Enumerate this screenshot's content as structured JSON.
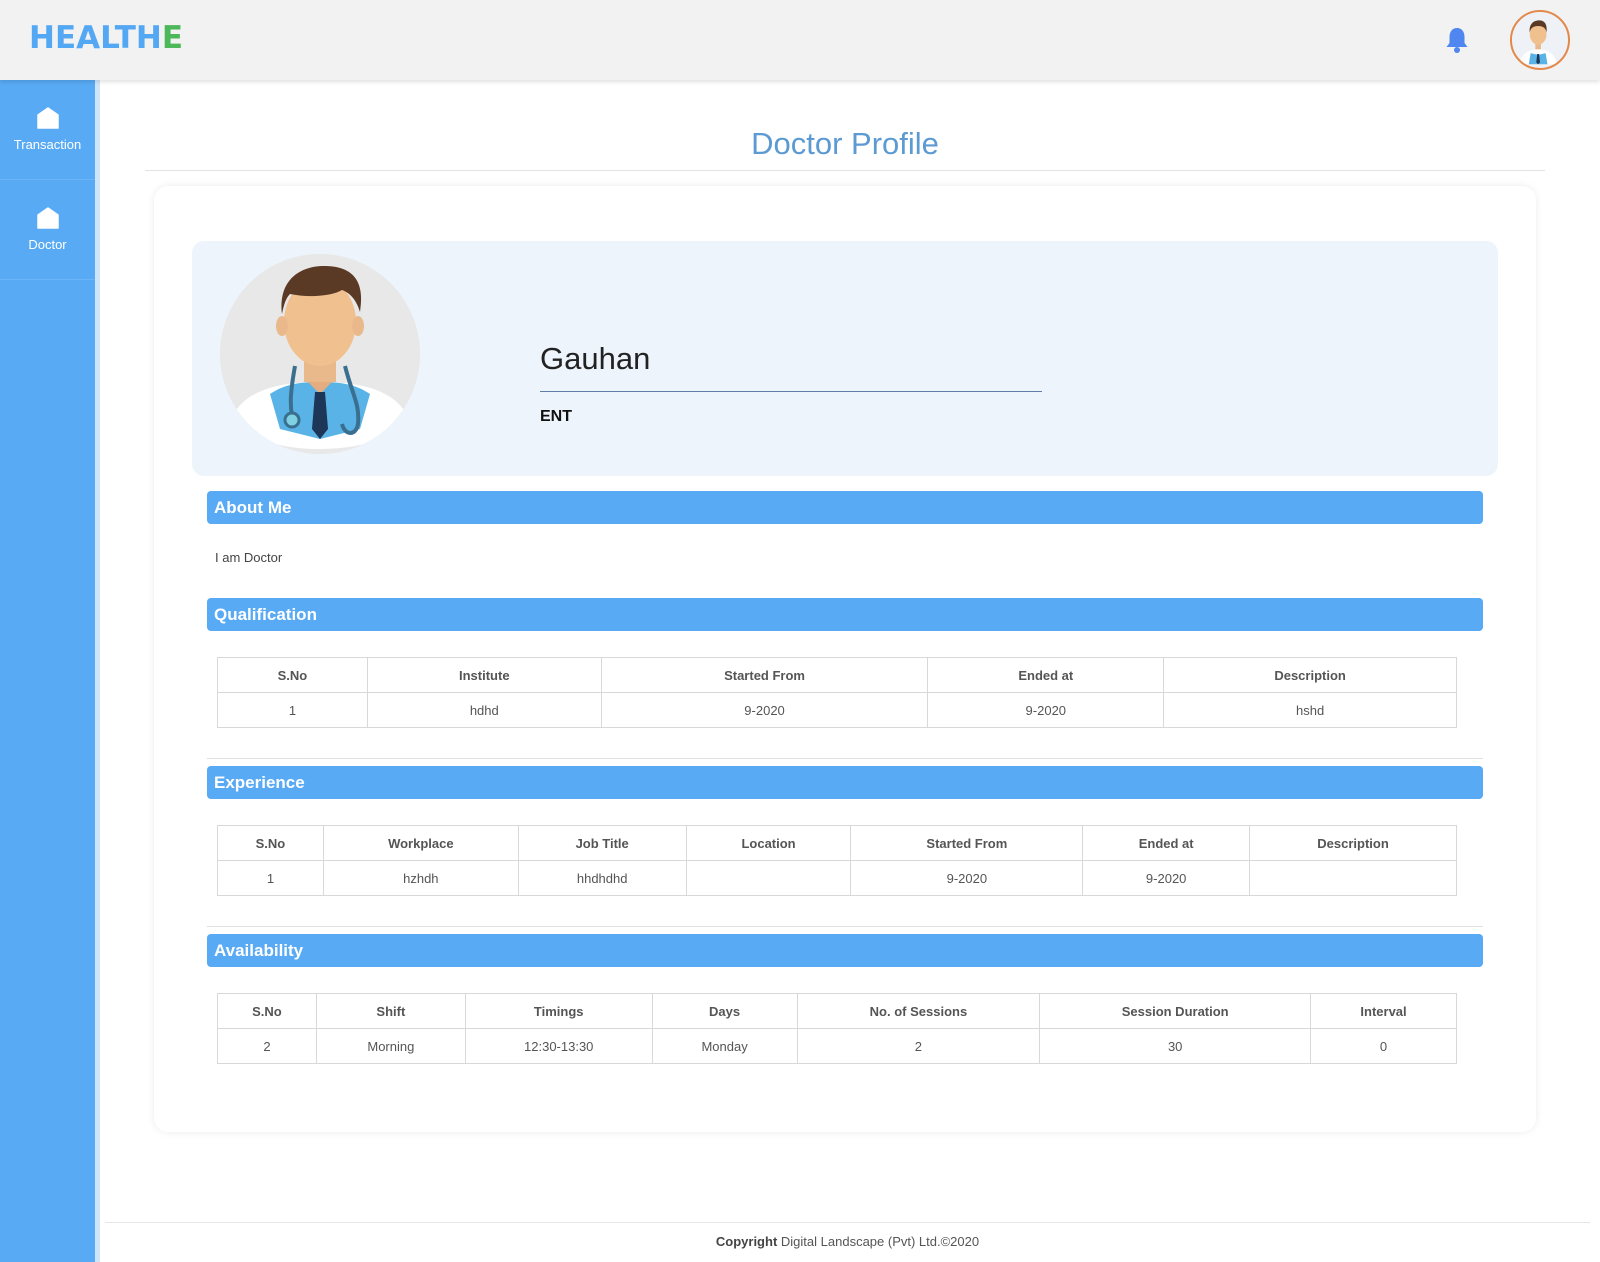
{
  "brand": {
    "name_main": "HEALTH",
    "name_accent": "E",
    "main_color": "#54a8f3",
    "accent_color": "#4cb859"
  },
  "header": {
    "bell_icon": "bell-icon",
    "avatar": "doctor-avatar"
  },
  "sidebar": {
    "items": [
      {
        "label": "Transaction",
        "icon": "home-icon"
      },
      {
        "label": "Doctor",
        "icon": "home-icon"
      }
    ]
  },
  "page": {
    "title": "Doctor Profile"
  },
  "profile": {
    "name": "Gauhan",
    "specialty": "ENT"
  },
  "about": {
    "heading": "About Me",
    "text": "I am Doctor"
  },
  "qualification": {
    "heading": "Qualification",
    "columns": [
      "S.No",
      "Institute",
      "Started From",
      "Ended at",
      "Description"
    ],
    "rows": [
      [
        "1",
        "hdhd",
        "9-2020",
        "9-2020",
        "hshd"
      ]
    ]
  },
  "experience": {
    "heading": "Experience",
    "columns": [
      "S.No",
      "Workplace",
      "Job Title",
      "Location",
      "Started From",
      "Ended at",
      "Description"
    ],
    "rows": [
      [
        "1",
        "hzhdh",
        "hhdhdhd",
        "",
        "9-2020",
        "9-2020",
        ""
      ]
    ]
  },
  "availability": {
    "heading": "Availability",
    "columns": [
      "S.No",
      "Shift",
      "Timings",
      "Days",
      "No. of Sessions",
      "Session Duration",
      "Interval"
    ],
    "rows": [
      [
        "2",
        "Morning",
        "12:30-13:30",
        "Monday",
        "2",
        "30",
        "0"
      ]
    ]
  },
  "footer": {
    "label": "Copyright",
    "text": "Digital Landscape (Pvt) Ltd.©2020"
  }
}
